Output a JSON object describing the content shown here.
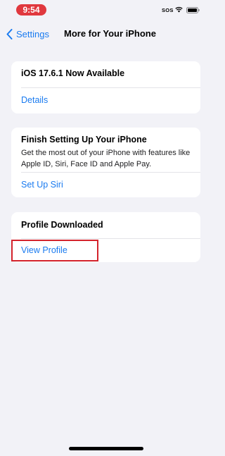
{
  "status_bar": {
    "time": "9:54",
    "carrier": "SOS",
    "icons": [
      "wifi-icon",
      "battery-icon"
    ]
  },
  "nav": {
    "back_label": "Settings",
    "title": "More for Your iPhone"
  },
  "cards": {
    "update": {
      "title": "iOS 17.6.1 Now Available",
      "link": "Details"
    },
    "setup": {
      "title": "Finish Setting Up Your iPhone",
      "body": "Get the most out of your iPhone with features like Apple ID, Siri, Face ID and Apple Pay.",
      "link": "Set Up Siri"
    },
    "profile": {
      "title": "Profile Downloaded",
      "link": "View Profile"
    }
  },
  "colors": {
    "accent": "#1a7bf0",
    "background": "#f2f2f7",
    "time_pill": "#e0383e",
    "highlight": "#d4232c"
  }
}
